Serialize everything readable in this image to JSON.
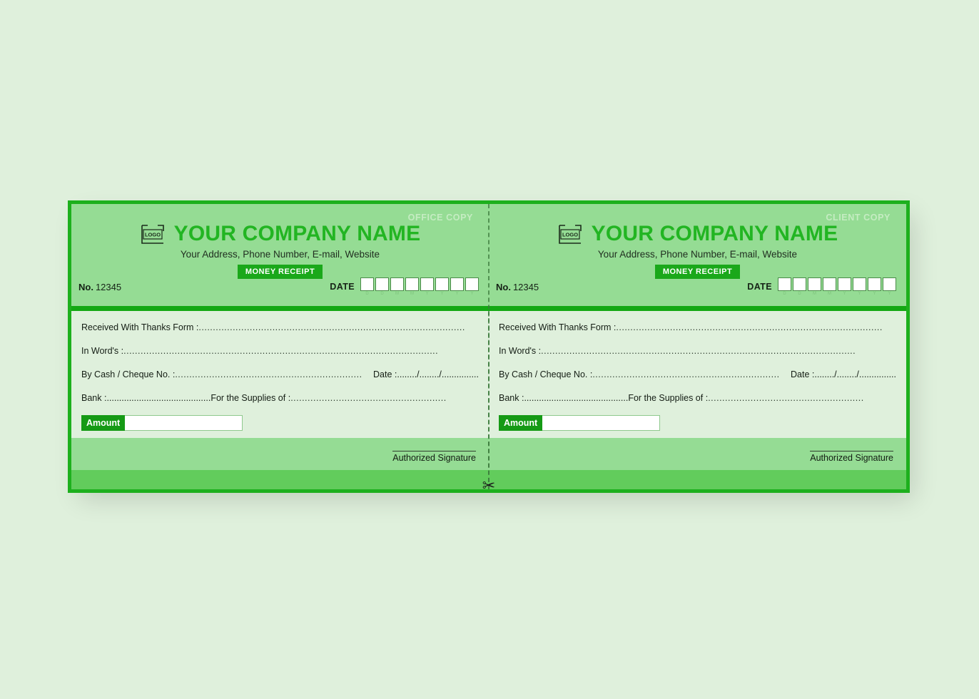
{
  "page": {
    "background_color": "#dff0dc",
    "accent_green": "#1db01d",
    "badge_green": "#1aa81a",
    "header_green": "#95dc94",
    "body_green": "#dff0dc",
    "strip_green": "#62cc5c"
  },
  "receipt": {
    "cut_icon": "scissors-icon",
    "copies": [
      {
        "copy_tag": "OFFICE COPY",
        "logo_text": "LOGO",
        "company_name": "YOUR COMPANY NAME",
        "company_address": "Your Address, Phone Number, E-mail, Website",
        "badge_label": "MONEY RECEIPT",
        "no_label": "No.",
        "no_value": "12345",
        "date_label": "DATE",
        "date_cells": [
          "D",
          "D",
          "M",
          "M",
          "Y",
          "Y",
          "Y",
          "Y"
        ],
        "fields": {
          "received_label": "Received With Thanks Form :",
          "received_dots": "..............................................................................................",
          "in_words_label": "In Word's :",
          "in_words_dots": "...............................................................................................................",
          "cheque_label": "By Cash / Cheque  No. :",
          "cheque_dots": "..................................................................",
          "cheque_date_label": "Date :",
          "cheque_date_dots": "......../......../...............",
          "bank_label": "Bank :",
          "bank_dots": "..........................................",
          "supplies_label": "For the Supplies of :",
          "supplies_dots": "......................................................."
        },
        "amount_label": "Amount",
        "amount_value": "",
        "signature_label": "Authorized Signature"
      },
      {
        "copy_tag": "CLIENT COPY",
        "logo_text": "LOGO",
        "company_name": "YOUR COMPANY NAME",
        "company_address": "Your Address, Phone Number, E-mail, Website",
        "badge_label": "MONEY RECEIPT",
        "no_label": "No.",
        "no_value": "12345",
        "date_label": "DATE",
        "date_cells": [
          "D",
          "D",
          "M",
          "M",
          "Y",
          "Y",
          "Y",
          "Y"
        ],
        "fields": {
          "received_label": "Received With Thanks Form :",
          "received_dots": "..............................................................................................",
          "in_words_label": "In Word's :",
          "in_words_dots": "...............................................................................................................",
          "cheque_label": "By Cash / Cheque  No. :",
          "cheque_dots": "..................................................................",
          "cheque_date_label": "Date :",
          "cheque_date_dots": "......../......../...............",
          "bank_label": "Bank :",
          "bank_dots": "..........................................",
          "supplies_label": "For the Supplies of :",
          "supplies_dots": "......................................................."
        },
        "amount_label": "Amount",
        "amount_value": "",
        "signature_label": "Authorized Signature"
      }
    ]
  }
}
